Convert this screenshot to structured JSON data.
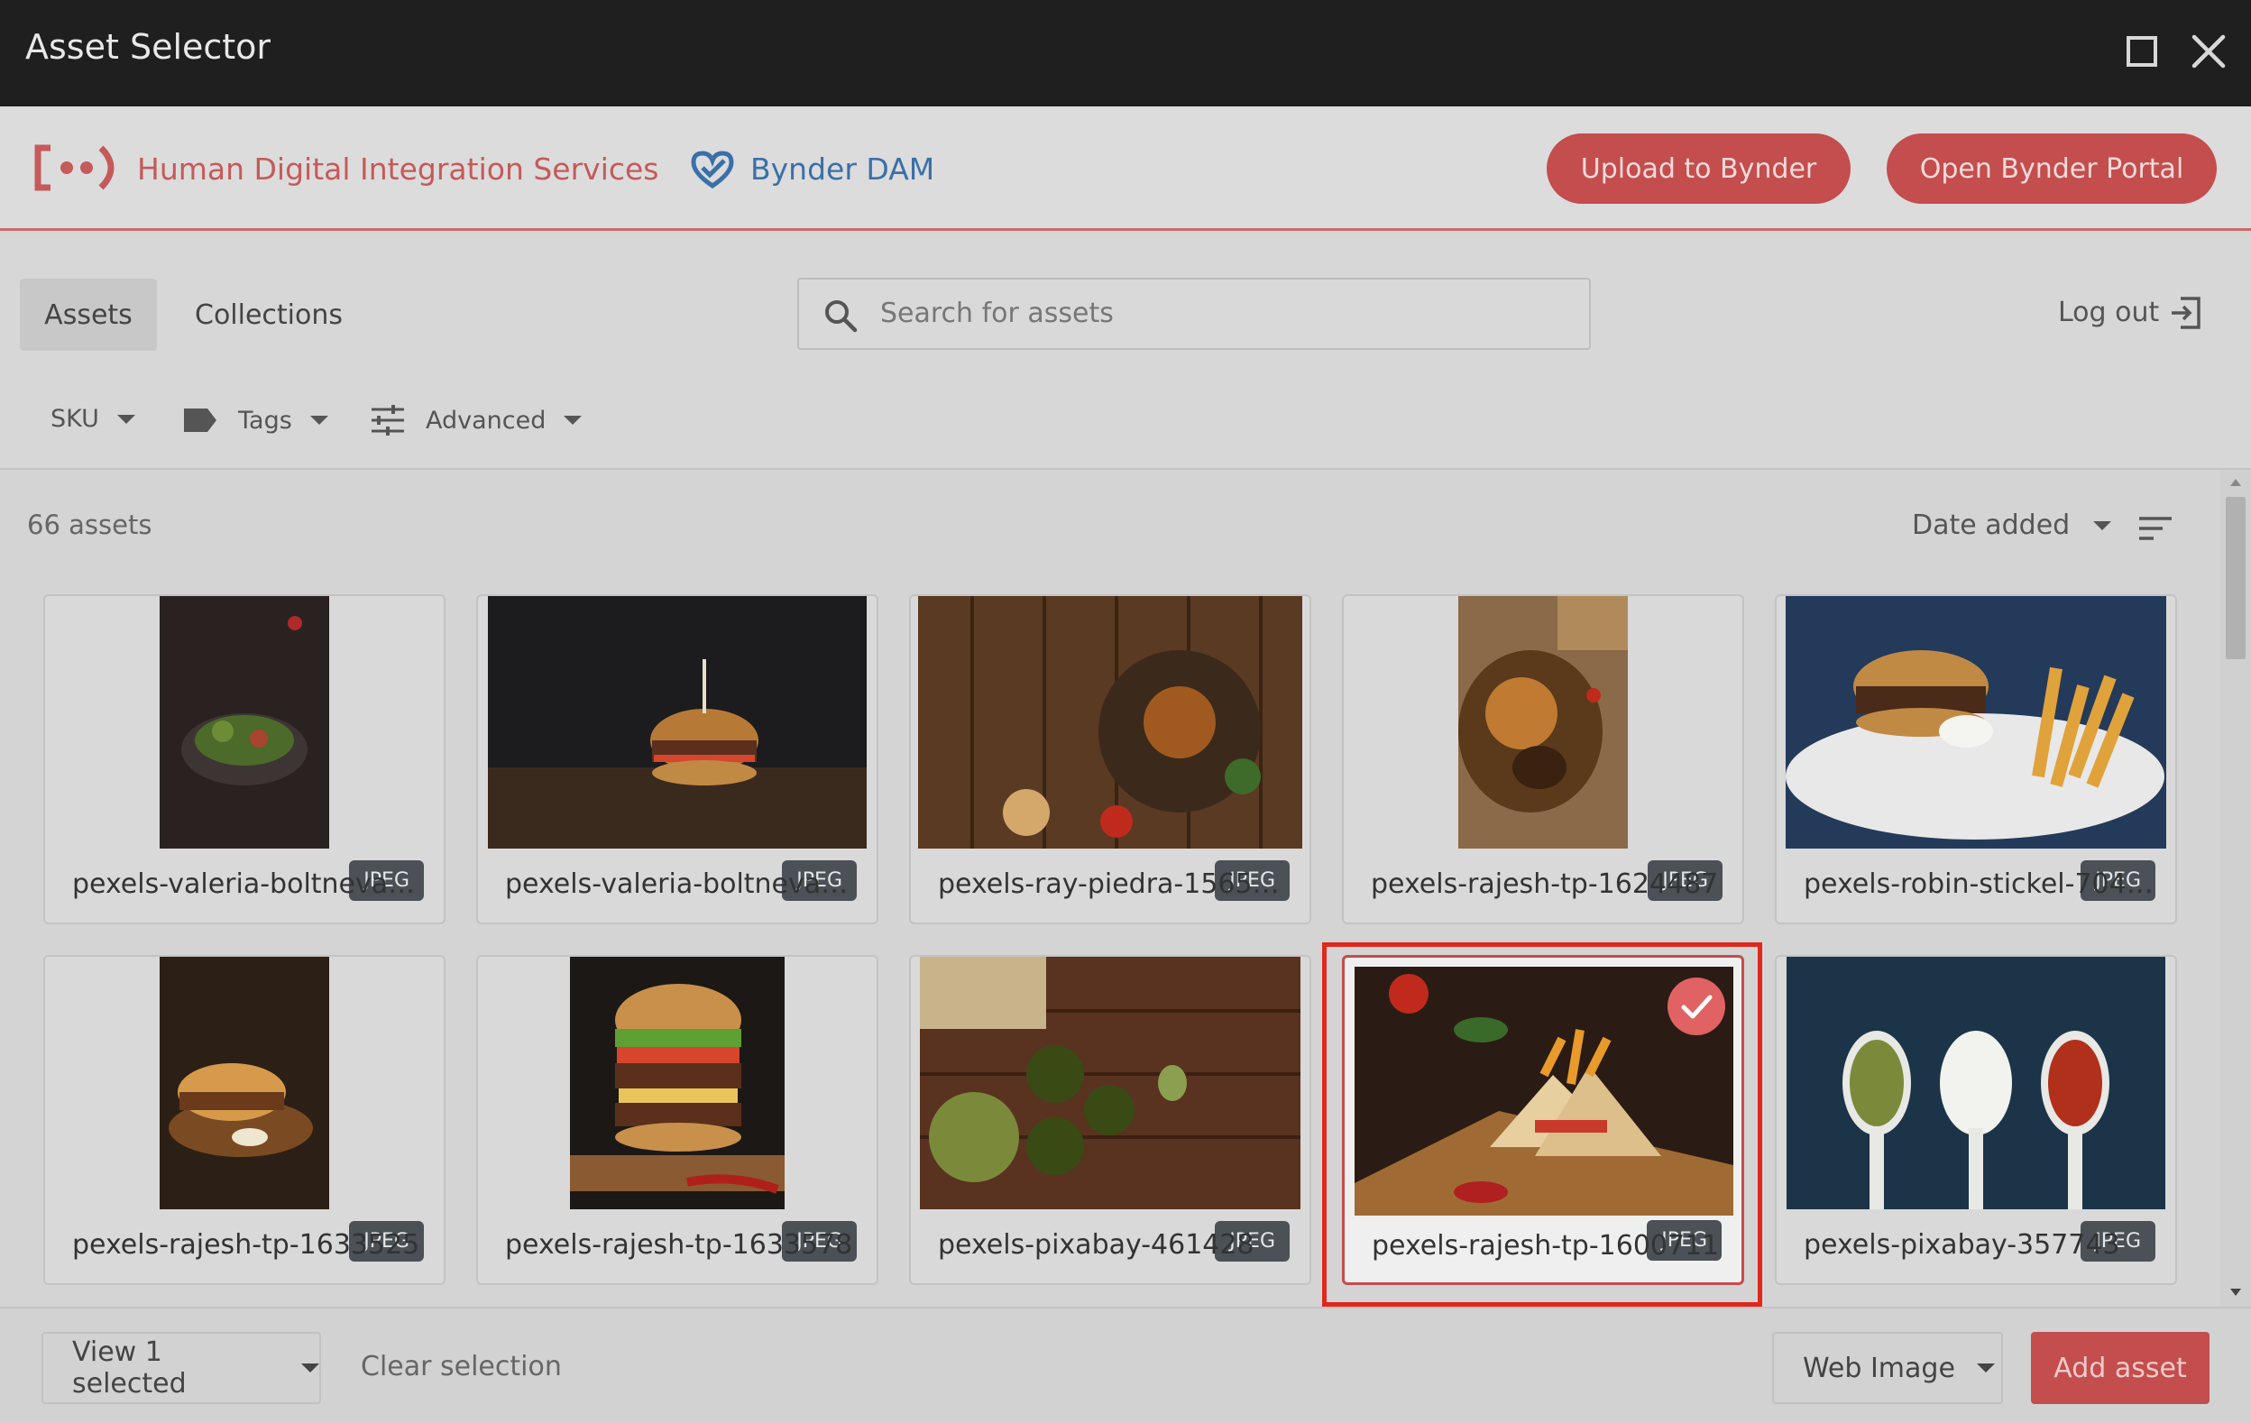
{
  "window": {
    "title": "Asset Selector",
    "maximize_icon": "maximize-icon",
    "close_icon": "close-icon"
  },
  "brand": {
    "company_name": "Human Digital Integration Services",
    "dam_name": "Bynder DAM",
    "upload_button": "Upload to Bynder",
    "portal_button": "Open Bynder Portal",
    "accent_color": "#c44d4d"
  },
  "nav": {
    "tabs": [
      {
        "label": "Assets",
        "active": true
      },
      {
        "label": "Collections",
        "active": false
      }
    ],
    "search_placeholder": "Search for assets",
    "logout_label": "Log out"
  },
  "filters": [
    {
      "label": "SKU",
      "icon": ""
    },
    {
      "label": "Tags",
      "icon": "tag-icon"
    },
    {
      "label": "Advanced",
      "icon": "sliders-icon"
    }
  ],
  "results": {
    "count_label": "66 assets",
    "sort_label": "Date added"
  },
  "assets": [
    {
      "name": "pexels-valeria-boltneva-8...",
      "type": "JPEG",
      "selected": false
    },
    {
      "name": "pexels-valeria-boltneva-1...",
      "type": "JPEG",
      "selected": false
    },
    {
      "name": "pexels-ray-piedra-1565982",
      "type": "JPEG",
      "selected": false
    },
    {
      "name": "pexels-rajesh-tp-1624487",
      "type": "JPEG",
      "selected": false
    },
    {
      "name": "pexels-robin-stickel-70497",
      "type": "JPEG",
      "selected": false
    },
    {
      "name": "pexels-rajesh-tp-1633525",
      "type": "JPEG",
      "selected": false
    },
    {
      "name": "pexels-rajesh-tp-1633578",
      "type": "JPEG",
      "selected": false
    },
    {
      "name": "pexels-pixabay-461428",
      "type": "JPEG",
      "selected": false
    },
    {
      "name": "pexels-rajesh-tp-1600711",
      "type": "JPEG",
      "selected": true
    },
    {
      "name": "pexels-pixabay-357743",
      "type": "JPEG",
      "selected": false
    }
  ],
  "footer": {
    "view_selected": "View 1 selected",
    "clear_selection": "Clear selection",
    "format": "Web Image",
    "add_asset": "Add asset"
  }
}
